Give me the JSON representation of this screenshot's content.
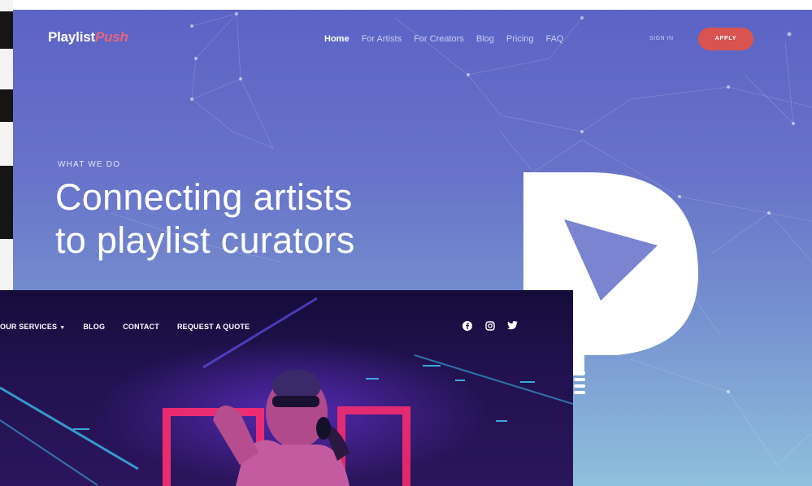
{
  "playlist_push": {
    "logo": {
      "brand": "Playlist",
      "accent": "Push"
    },
    "nav": [
      {
        "label": "Home",
        "active": true
      },
      {
        "label": "For Artists",
        "active": false
      },
      {
        "label": "For Creators",
        "active": false
      },
      {
        "label": "Blog",
        "active": false
      },
      {
        "label": "Pricing",
        "active": false
      },
      {
        "label": "FAQ",
        "active": false
      }
    ],
    "sign_in_label": "SIGN IN",
    "apply_label": "APPLY",
    "eyebrow": "WHAT WE DO",
    "headline_line1": "Connecting artists",
    "headline_line2": "to playlist curators",
    "colors": {
      "accent": "#d9534f",
      "bg_top": "#5b63c5",
      "bg_bottom": "#8fc0dc"
    },
    "icons": [
      "p-play-logo-icon"
    ]
  },
  "music_site": {
    "nav": [
      {
        "label": "OUR SERVICES",
        "has_dropdown": true
      },
      {
        "label": "BLOG",
        "has_dropdown": false
      },
      {
        "label": "CONTACT",
        "has_dropdown": false
      },
      {
        "label": "REQUEST A QUOTE",
        "has_dropdown": false
      }
    ],
    "social_icons": [
      "facebook-icon",
      "instagram-icon",
      "twitter-icon"
    ],
    "colors": {
      "neon_pink": "#ff2d6f",
      "neon_cyan": "#3fd0ff",
      "bg": "#1a0f45"
    }
  }
}
